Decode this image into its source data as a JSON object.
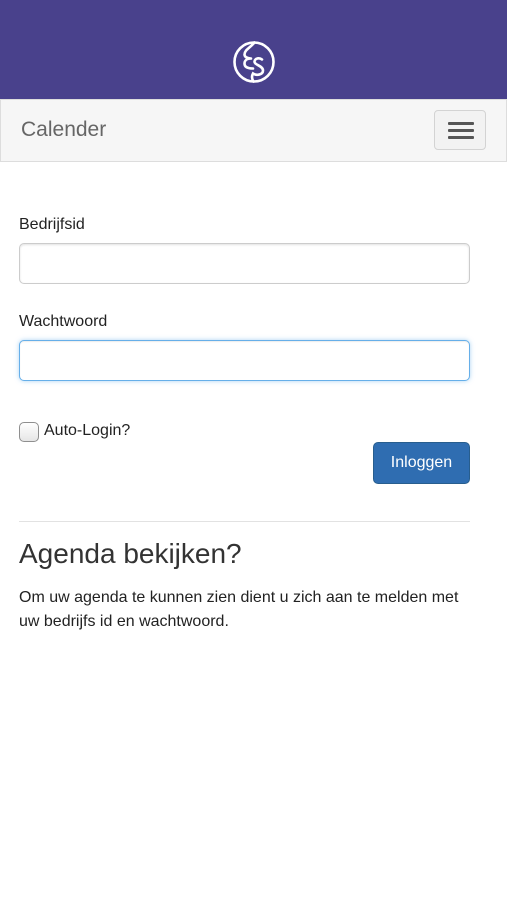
{
  "header": {
    "logo_icon": "es-circle-logo-icon",
    "background_color": "#49418c"
  },
  "navbar": {
    "brand": "Calender",
    "menu_icon": "hamburger-menu-icon"
  },
  "form": {
    "company_id_label": "Bedrijfsid",
    "company_id_value": "",
    "password_label": "Wachtwoord",
    "password_value": "",
    "auto_login_label": "Auto-Login?",
    "auto_login_checked": false,
    "login_button": "Inloggen",
    "login_button_color": "#2f6db1"
  },
  "info": {
    "heading": "Agenda bekijken?",
    "text": "Om uw agenda te kunnen zien dient u zich aan te melden met uw bedrijfs id en wachtwoord."
  }
}
